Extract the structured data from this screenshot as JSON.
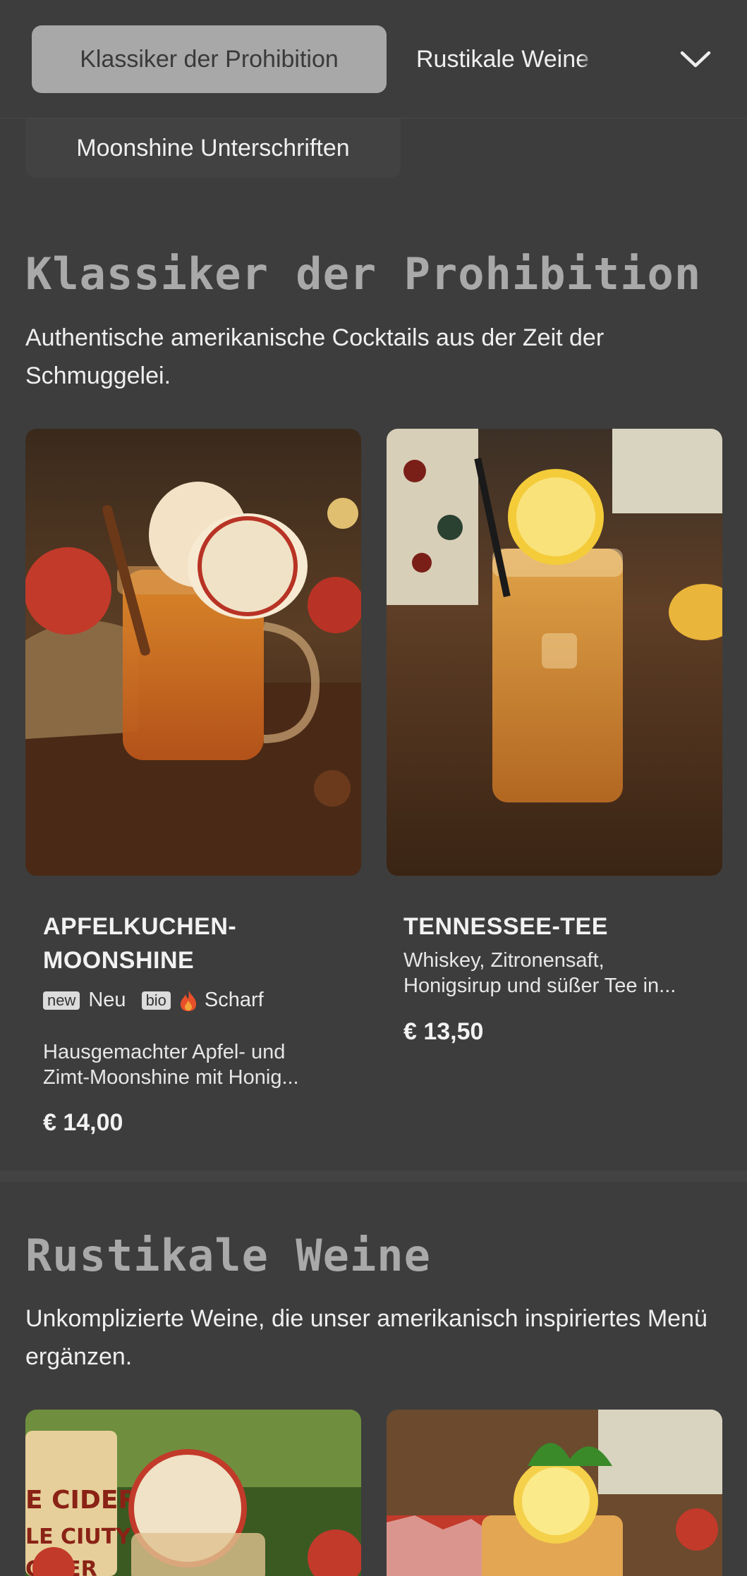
{
  "nav": {
    "active_tab": "Klassiker der Prohibition",
    "next_tab_main": "Rustikale Wei",
    "next_tab_fade": "ne",
    "second_row_tab": "Moonshine Unterschriften",
    "expand_icon": "chevron-down-icon"
  },
  "section1": {
    "title": "Klassiker der Prohibition",
    "description": "Authentische amerikanische Cocktails aus der Zeit der Schmuggelei.",
    "items": [
      {
        "name": "APFELKUCHEN-MOONSHINE",
        "name_line1": "APFELKUCHEN-",
        "name_line2": "MOONSHINE",
        "badge_new_tag": "new",
        "badge_new_label": "Neu",
        "badge_bio_tag": "bio",
        "badge_spicy_icon": "flame-icon",
        "badge_spicy_label": "Scharf",
        "description_line1": "Hausgemachter Apfel- und",
        "description_line2": "Zimt-Moonshine mit Honig...",
        "price": "€ 14,00"
      },
      {
        "name": "TENNESSEE-TEE",
        "description_line1": "Whiskey, Zitronensaft,",
        "description_line2": "Honigsirup und süßer Tee in...",
        "price": "€ 13,50"
      }
    ]
  },
  "section2": {
    "title": "Rustikale Weine",
    "description": "Unkomplizierte Weine, die unser amerikanisch inspiriertes Menü ergänzen.",
    "sign_text_1": "E CIDER",
    "sign_text_2": "LE CIUTY",
    "sign_text_3": "CIDER"
  },
  "colors": {
    "background": "#3d3d3d",
    "active_pill": "#a8a8a8",
    "section_title": "#a9a9a9"
  }
}
